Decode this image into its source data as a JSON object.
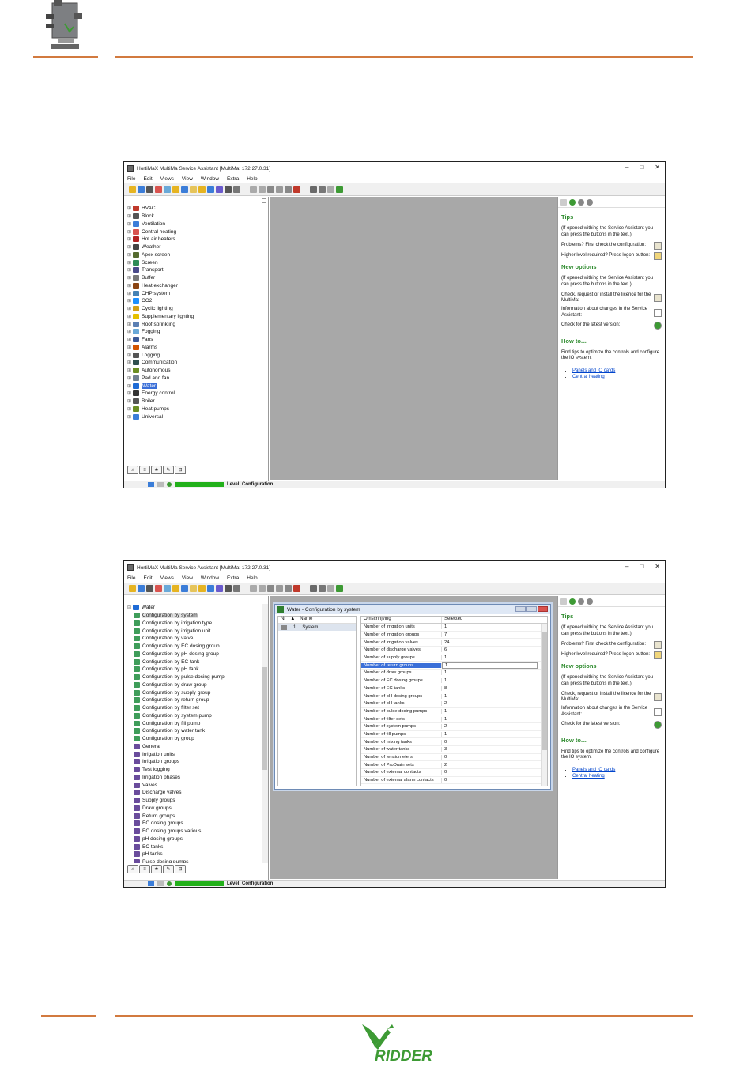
{
  "colors": {
    "accent": "#d27a3f",
    "brand_green": "#3d9a34"
  },
  "footer": {
    "logo_text": "RIDDER"
  },
  "screenshots": [
    {
      "title": "HortiMaX MultiMa Service Assistant [MultiMa: 172.27.0.31]",
      "menu": [
        "File",
        "Edit",
        "Views",
        "View",
        "Window",
        "Extra",
        "Help"
      ],
      "tree": [
        {
          "label": "HVAC",
          "color": "#c0392b"
        },
        {
          "label": "Block",
          "color": "#555"
        },
        {
          "label": "Ventilation",
          "color": "#3b7dd8"
        },
        {
          "label": "Central heating",
          "color": "#d9534f"
        },
        {
          "label": "Hot air heaters",
          "color": "#b22222"
        },
        {
          "label": "Weather",
          "color": "#444"
        },
        {
          "label": "Apex screen",
          "color": "#556b2f"
        },
        {
          "label": "Screen",
          "color": "#2e8b57"
        },
        {
          "label": "Transport",
          "color": "#4a4a8a"
        },
        {
          "label": "Buffer",
          "color": "#777"
        },
        {
          "label": "Heat exchanger",
          "color": "#8b4513"
        },
        {
          "label": "CHP system",
          "color": "#4682b4"
        },
        {
          "label": "CO2",
          "color": "#1e90ff"
        },
        {
          "label": "Cyclic lighting",
          "color": "#d4a017"
        },
        {
          "label": "Supplementary lighting",
          "color": "#e5c100"
        },
        {
          "label": "Roof sprinkling",
          "color": "#5b7fb3"
        },
        {
          "label": "Fogging",
          "color": "#6aa9d8"
        },
        {
          "label": "Fans",
          "color": "#3b5998"
        },
        {
          "label": "Alarms",
          "color": "#d35400"
        },
        {
          "label": "Logging",
          "color": "#555"
        },
        {
          "label": "Communication",
          "color": "#2f4f4f"
        },
        {
          "label": "Autonomous",
          "color": "#6b8e23"
        },
        {
          "label": "Pad and fan",
          "color": "#708090"
        },
        {
          "label": "Water",
          "color": "#1e6bd6",
          "selected": true
        },
        {
          "label": "Energy control",
          "color": "#333"
        },
        {
          "label": "Boiler",
          "color": "#555"
        },
        {
          "label": "Heat pumps",
          "color": "#6b8e23"
        },
        {
          "label": "Universal",
          "color": "#3b7dd8"
        }
      ],
      "status_level": "Level: Configuration"
    },
    {
      "title": "HortiMaX MultiMa Service Assistant [MultiMa: 172.27.0.31]",
      "menu": [
        "File",
        "Edit",
        "Views",
        "View",
        "Window",
        "Extra",
        "Help"
      ],
      "tree_root": "Water",
      "tree": [
        "Configuration by system",
        "Configuration by irrigation type",
        "Configuration by irrigation unit",
        "Configuration by valve",
        "Configuration by EC dosing group",
        "Configuration by pH dosing group",
        "Configuration by EC tank",
        "Configuration by pH tank",
        "Configuration by pulse dosing pump",
        "Configuration by draw group",
        "Configuration by supply group",
        "Configuration by return group",
        "Configuration by filter set",
        "Configuration by system pump",
        "Configuration by fill pump",
        "Configuration by water tank",
        "Configuration by group",
        "General",
        "Irrigation units",
        "Irrigation groups",
        "Test logging",
        "Irrigation phases",
        "Valves",
        "Discharge valves",
        "Supply groups",
        "Draw groups",
        "Return groups",
        "EC dosing groups",
        "EC dosing groups various",
        "pH dosing groups",
        "EC tanks",
        "pH tanks",
        "Pulse dosing pumps"
      ],
      "status_level": "Level: Configuration",
      "subwindow": {
        "title": "Water - Configuration by system",
        "list_headers": [
          "Nr",
          "Name"
        ],
        "list_rows": [
          {
            "nr": "1",
            "name": "System"
          }
        ],
        "table_headers": [
          "Omschrijving",
          "Selected"
        ],
        "rows": [
          {
            "label": "Number of irrigation units",
            "value": "1"
          },
          {
            "label": "Number of irrigation groups",
            "value": "7"
          },
          {
            "label": "Number of irrigation valves",
            "value": "24"
          },
          {
            "label": "Number of discharge valves",
            "value": "6"
          },
          {
            "label": "Number of supply groups",
            "value": "1"
          },
          {
            "label": "Number of return groups",
            "value": "1",
            "selected": true
          },
          {
            "label": "Number of draw groups",
            "value": "1"
          },
          {
            "label": "Number of EC dosing groups",
            "value": "1"
          },
          {
            "label": "Number of EC tanks",
            "value": "8"
          },
          {
            "label": "Number of pH dosing groups",
            "value": "1"
          },
          {
            "label": "Number of pH tanks",
            "value": "2"
          },
          {
            "label": "Number of pulse dosing pumps",
            "value": "1"
          },
          {
            "label": "Number of filter sets",
            "value": "1"
          },
          {
            "label": "Number of system pumps",
            "value": "2"
          },
          {
            "label": "Number of fill pumps",
            "value": "1"
          },
          {
            "label": "Number of mixing tanks",
            "value": "0"
          },
          {
            "label": "Number of water tanks",
            "value": "3"
          },
          {
            "label": "Number of tensiometers",
            "value": "0"
          },
          {
            "label": "Number of ProDrain sets",
            "value": "2"
          },
          {
            "label": "Number of external contacts",
            "value": "0"
          },
          {
            "label": "Number of external alarm contacts",
            "value": "0"
          }
        ]
      }
    }
  ],
  "tips_panel": {
    "tips_heading": "Tips",
    "tips_intro": "(If opened withing the Service Assistant you can press the buttons in the text.)",
    "problems": "Problems? First check the configuration:",
    "logon": "Higher level required? Press logon button:",
    "new_options_heading": "New options",
    "new_options_intro": "(If opened withing the Service Assistant you can press the buttons in the text.)",
    "licence": "Check, request or install the licence for the MultiMa:",
    "changes": "Information about changes in the Service Assistant:",
    "latest": "Check for the latest version:",
    "howto_heading": "How to....",
    "howto_text": "Find tips to optimize the controls and configure the IO system.",
    "links": [
      "Panels and IO cards",
      "Central heating"
    ]
  }
}
